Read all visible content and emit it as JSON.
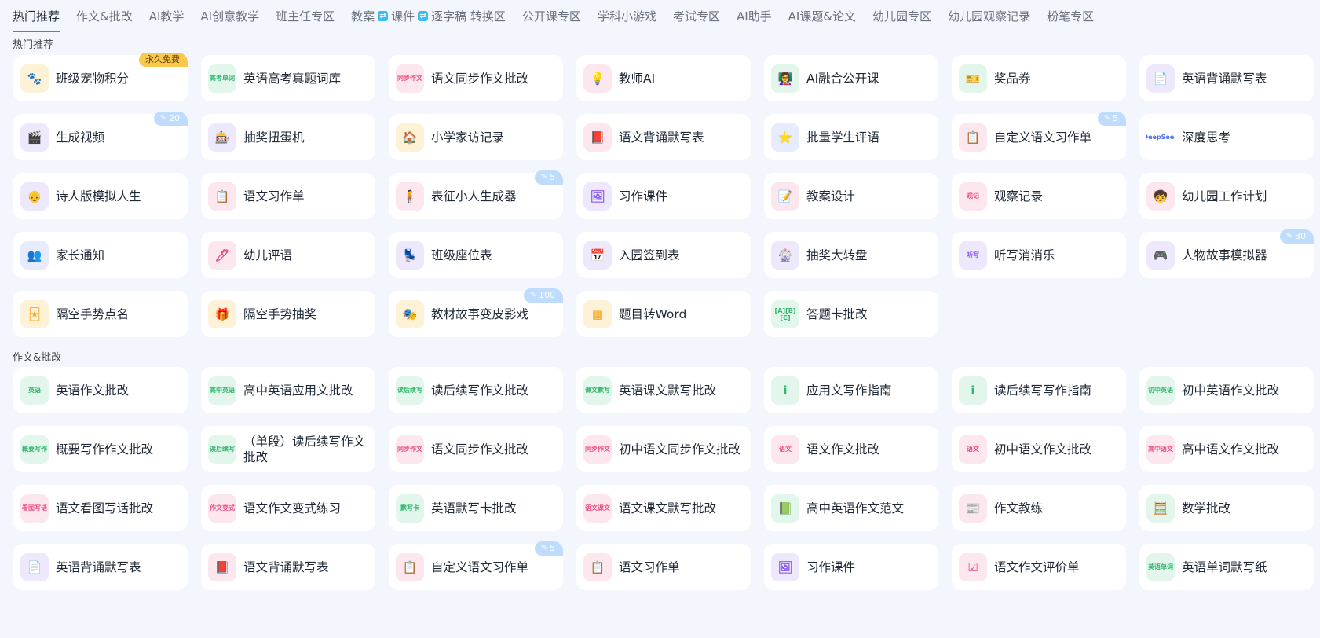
{
  "nav": {
    "tabs": [
      {
        "label": "热门推荐",
        "active": true
      },
      {
        "label": "作文&批改"
      },
      {
        "label": "AI教学"
      },
      {
        "label": "AI创意教学"
      },
      {
        "label": "班主任专区"
      },
      {
        "label": "教案",
        "extra": [
          {
            "badge": "⇄",
            "label": "课件"
          },
          {
            "badge": "⇄",
            "label": "逐字稿 转换区"
          }
        ]
      },
      {
        "label": "公开课专区"
      },
      {
        "label": "学科小游戏"
      },
      {
        "label": "考试专区"
      },
      {
        "label": "AI助手"
      },
      {
        "label": "AI课题&论文"
      },
      {
        "label": "幼儿园专区"
      },
      {
        "label": "幼儿园观察记录"
      },
      {
        "label": "粉笔专区"
      }
    ]
  },
  "sections": [
    {
      "title": "热门推荐",
      "items": [
        {
          "label": "班级宠物积分",
          "icon": "paw-icon",
          "glyph": "🐾",
          "theme": "t-amber",
          "badge": "永久免费",
          "badge_type": "gold"
        },
        {
          "label": "英语高考真题词库",
          "icon": "book-icon",
          "glyph": "高考单词",
          "small": true,
          "theme": "t-green"
        },
        {
          "label": "语文同步作文批改",
          "icon": "edit-plus-icon",
          "glyph": "同步作文",
          "small": true,
          "theme": "t-pink"
        },
        {
          "label": "教师AI",
          "icon": "bulb-icon",
          "glyph": "💡",
          "theme": "t-pink"
        },
        {
          "label": "AI融合公开课",
          "icon": "teacher-icon",
          "glyph": "👩‍🏫",
          "theme": "t-green"
        },
        {
          "label": "奖品券",
          "icon": "ticket-icon",
          "glyph": "🎫",
          "theme": "t-green"
        },
        {
          "label": "英语背诵默写表",
          "icon": "document-icon",
          "glyph": "📄",
          "theme": "t-purple"
        },
        {
          "label": "生成视频",
          "icon": "video-icon",
          "glyph": "🎬",
          "theme": "t-purple",
          "badge": "20"
        },
        {
          "label": "抽奖扭蛋机",
          "icon": "gacha-icon",
          "glyph": "🎰",
          "theme": "t-purple"
        },
        {
          "label": "小学家访记录",
          "icon": "home-visit-icon",
          "glyph": "🏠",
          "theme": "t-amber"
        },
        {
          "label": "语文背诵默写表",
          "icon": "notebook-icon",
          "glyph": "📕",
          "theme": "t-pink"
        },
        {
          "label": "批量学生评语",
          "icon": "stars-icon",
          "glyph": "⭐",
          "theme": "t-blue"
        },
        {
          "label": "自定义语文习作单",
          "icon": "clipboard-icon",
          "glyph": "📋",
          "theme": "t-pink",
          "badge": "5"
        },
        {
          "label": "深度思考",
          "icon": "deepseek-icon",
          "glyph": "DeepSeek",
          "small": true,
          "theme": "t-white"
        },
        {
          "label": "诗人版模拟人生",
          "icon": "poet-icon",
          "glyph": "👴",
          "theme": "t-purple"
        },
        {
          "label": "语文习作单",
          "icon": "worksheet-icon",
          "glyph": "📋",
          "theme": "t-pink"
        },
        {
          "label": "表征小人生成器",
          "icon": "figure-icon",
          "glyph": "🧍",
          "theme": "t-pink",
          "badge": "5"
        },
        {
          "label": "习作课件",
          "icon": "courseware-icon",
          "glyph": "🖼",
          "theme": "t-purple"
        },
        {
          "label": "教案设计",
          "icon": "lesson-plan-icon",
          "glyph": "📝",
          "theme": "t-pink"
        },
        {
          "label": "观察记录",
          "icon": "observe-icon",
          "glyph": "观记",
          "small": true,
          "theme": "t-pink"
        },
        {
          "label": "幼儿园工作计划",
          "icon": "child-icon",
          "glyph": "🧒",
          "theme": "t-pink"
        },
        {
          "label": "家长通知",
          "icon": "parents-icon",
          "glyph": "👥",
          "theme": "t-blue"
        },
        {
          "label": "幼儿评语",
          "icon": "comment-icon",
          "glyph": "🖊",
          "theme": "t-pink"
        },
        {
          "label": "班级座位表",
          "icon": "seats-icon",
          "glyph": "💺",
          "theme": "t-purple"
        },
        {
          "label": "入园签到表",
          "icon": "calendar-icon",
          "glyph": "📅",
          "theme": "t-purple"
        },
        {
          "label": "抽奖大转盘",
          "icon": "wheel-icon",
          "glyph": "🎡",
          "theme": "t-purple"
        },
        {
          "label": "听写消消乐",
          "icon": "grid-icon",
          "glyph": "听写",
          "small": true,
          "theme": "t-purple"
        },
        {
          "label": "人物故事模拟器",
          "icon": "gamepad-icon",
          "glyph": "🎮",
          "theme": "t-purple",
          "badge": "30"
        },
        {
          "label": "隔空手势点名",
          "icon": "cards-icon",
          "glyph": "🃏",
          "theme": "t-amber"
        },
        {
          "label": "隔空手势抽奖",
          "icon": "gift-icon",
          "glyph": "🎁",
          "theme": "t-amber"
        },
        {
          "label": "教材故事变皮影戏",
          "icon": "puppet-icon",
          "glyph": "🎭",
          "theme": "t-amber",
          "badge": "100"
        },
        {
          "label": "题目转Word",
          "icon": "tiles-icon",
          "glyph": "▦",
          "theme": "t-amber"
        },
        {
          "label": "答题卡批改",
          "icon": "answer-sheet-icon",
          "glyph": "[A][B][C]",
          "small": true,
          "theme": "t-green"
        }
      ]
    },
    {
      "title": "作文&批改",
      "items": [
        {
          "label": "英语作文批改",
          "icon": "english-essay-icon",
          "glyph": "英语",
          "small": true,
          "theme": "t-green"
        },
        {
          "label": "高中英语应用文批改",
          "icon": "hs-english-icon",
          "glyph": "高中英语",
          "small": true,
          "theme": "t-green"
        },
        {
          "label": "读后续写作文批改",
          "icon": "continuation-icon",
          "glyph": "读后续写",
          "small": true,
          "theme": "t-green"
        },
        {
          "label": "英语课文默写批改",
          "icon": "dictation-icon",
          "glyph": "课文默写",
          "small": true,
          "theme": "t-green"
        },
        {
          "label": "应用文写作指南",
          "icon": "guide-icon",
          "glyph": "i",
          "theme": "t-green"
        },
        {
          "label": "读后续写写作指南",
          "icon": "guide-icon",
          "glyph": "i",
          "theme": "t-green"
        },
        {
          "label": "初中英语作文批改",
          "icon": "jh-english-icon",
          "glyph": "初中英语",
          "small": true,
          "theme": "t-green"
        },
        {
          "label": "概要写作作文批改",
          "icon": "summary-icon",
          "glyph": "概要写作",
          "small": true,
          "theme": "t-green"
        },
        {
          "label": "（单段）读后续写作文批改",
          "icon": "continuation-icon",
          "glyph": "读后续写",
          "small": true,
          "theme": "t-green"
        },
        {
          "label": "语文同步作文批改",
          "icon": "edit-plus-icon",
          "glyph": "同步作文",
          "small": true,
          "theme": "t-pink"
        },
        {
          "label": "初中语文同步作文批改",
          "icon": "edit-plus-icon",
          "glyph": "同步作文",
          "small": true,
          "theme": "t-pink"
        },
        {
          "label": "语文作文批改",
          "icon": "edit-plus-icon",
          "glyph": "语文",
          "small": true,
          "theme": "t-pink"
        },
        {
          "label": "初中语文作文批改",
          "icon": "edit-plus-icon",
          "glyph": "语文",
          "small": true,
          "theme": "t-pink"
        },
        {
          "label": "高中语文作文批改",
          "icon": "edit-plus-icon",
          "glyph": "高中语文",
          "small": true,
          "theme": "t-pink"
        },
        {
          "label": "语文看图写话批改",
          "icon": "edit-plus-icon",
          "glyph": "看图写话",
          "small": true,
          "theme": "t-pink"
        },
        {
          "label": "语文作文变式练习",
          "icon": "variant-icon",
          "glyph": "作文变式",
          "small": true,
          "theme": "t-pink"
        },
        {
          "label": "英语默写卡批改",
          "icon": "card-icon",
          "glyph": "默写卡",
          "small": true,
          "theme": "t-green"
        },
        {
          "label": "语文课文默写批改",
          "icon": "text-dictation-icon",
          "glyph": "语文课文",
          "small": true,
          "theme": "t-pink"
        },
        {
          "label": "高中英语作文范文",
          "icon": "sample-icon",
          "glyph": "📗",
          "theme": "t-green"
        },
        {
          "label": "作文教练",
          "icon": "coach-icon",
          "glyph": "📰",
          "theme": "t-pink"
        },
        {
          "label": "数学批改",
          "icon": "math-icon",
          "glyph": "🧮",
          "theme": "t-green"
        },
        {
          "label": "英语背诵默写表",
          "icon": "document-icon",
          "glyph": "📄",
          "theme": "t-purple"
        },
        {
          "label": "语文背诵默写表",
          "icon": "notebook-icon",
          "glyph": "📕",
          "theme": "t-pink"
        },
        {
          "label": "自定义语文习作单",
          "icon": "clipboard-icon",
          "glyph": "📋",
          "theme": "t-pink",
          "badge": "5"
        },
        {
          "label": "语文习作单",
          "icon": "worksheet-icon",
          "glyph": "📋",
          "theme": "t-pink"
        },
        {
          "label": "习作课件",
          "icon": "courseware-icon",
          "glyph": "🖼",
          "theme": "t-purple"
        },
        {
          "label": "语文作文评价单",
          "icon": "checklist-icon",
          "glyph": "☑",
          "theme": "t-pink"
        },
        {
          "label": "英语单词默写纸",
          "icon": "wordsheet-icon",
          "glyph": "英语单词",
          "small": true,
          "theme": "t-green"
        }
      ]
    }
  ]
}
